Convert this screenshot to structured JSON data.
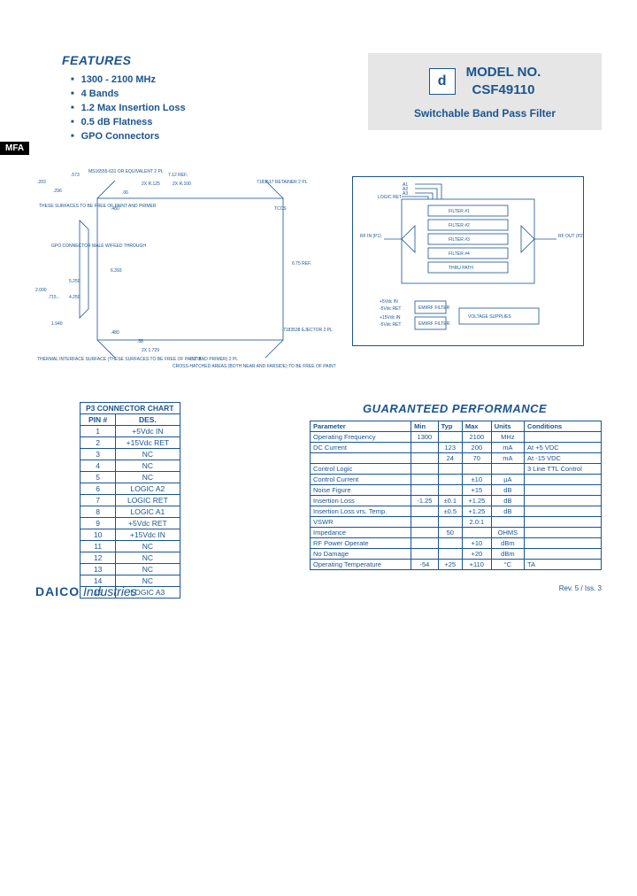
{
  "tag": "MFA",
  "features": {
    "heading": "FEATURES",
    "items": [
      "1300 - 2100 MHz",
      "4 Bands",
      "1.2 Max Insertion Loss",
      "0.5 dB Flatness",
      "GPO Connectors"
    ]
  },
  "model_box": {
    "logo_glyph": "d",
    "label_line1": "MODEL NO.",
    "label_line2": "CSF49110",
    "subtitle": "Switchable Band Pass Filter"
  },
  "mech_drawing": {
    "dims": {
      "w_ref": "7.12 REF.",
      "h_ref": "6.75 REF.",
      "left_203": ".203",
      "left_296": ".296",
      "left_573": ".573",
      "left_note1": "MS16555-631 OR EQUIVALENT 2 PL",
      "r125": "2X R.125",
      "r100": "2X R.100",
      "right_retainer": "7183517 RETAINER 2 PL",
      "tccs": "TCCS",
      "top_480": ".480",
      "top_06": ".06",
      "surfaces_note": "THESE SURFACES TO BE FREE OF PAINT AND PRIMER",
      "gpo_note": "GPO CONNECTOR MALE W/FEED THROUGH",
      "gpo_6393": "6.393",
      "left_2000": "2.000",
      "left_715": ".715",
      "left_arrow": "←",
      "left_5250": "5.250",
      "left_4250": "4.250",
      "left_1940": "1.940",
      "bot_480": ".480",
      "bot_58": ".58",
      "bot_2x1729": "2X 1.729",
      "bot_6778": "6.778",
      "ejector": "7183538 EJECTOR 2 PL",
      "thermal_note": "THERMAL INTERFACE SURFACE (THESE SURFACES TO BE FREE OF PAINT AND PRIMER) 2 PL",
      "hatch_note": "CROSS-HATCHED AREAS (BOTH NEAR AND FARSIDE) TO BE FREE OF PAINT AND PRIMER."
    }
  },
  "block_diagram": {
    "inputs": [
      "A1",
      "A2",
      "A3",
      "LOGIC RET"
    ],
    "rf_in": "RF IN (P1)",
    "rf_out": "RF OUT (P2)",
    "filters": [
      "FILTER #1",
      "FILTER #2",
      "FILTER #3",
      "FILTER #4",
      "THRU PATH"
    ],
    "power_pins": [
      "+5Vdc IN",
      "-5Vdc RET",
      "+15Vdc IN",
      "-5Vdc RET"
    ],
    "emi1": "EMI/RF FILTER",
    "emi2": "EMI/RF FILTER",
    "vs": "VOLTAGE SUPPLIES"
  },
  "pin_table": {
    "title": "P3 CONNECTOR CHART",
    "headers": [
      "PIN #",
      "DES."
    ],
    "rows": [
      [
        "1",
        "+5Vdc IN"
      ],
      [
        "2",
        "+15Vdc RET"
      ],
      [
        "3",
        "NC"
      ],
      [
        "4",
        "NC"
      ],
      [
        "5",
        "NC"
      ],
      [
        "6",
        "LOGIC A2"
      ],
      [
        "7",
        "LOGIC RET"
      ],
      [
        "8",
        "LOGIC A1"
      ],
      [
        "9",
        "+5Vdc RET"
      ],
      [
        "10",
        "+15Vdc IN"
      ],
      [
        "11",
        "NC"
      ],
      [
        "12",
        "NC"
      ],
      [
        "13",
        "NC"
      ],
      [
        "14",
        "NC"
      ],
      [
        "15",
        "LOGIC A3"
      ]
    ]
  },
  "perf_table": {
    "heading": "GUARANTEED PERFORMANCE",
    "headers": [
      "Parameter",
      "Min",
      "Typ",
      "Max",
      "Units",
      "Conditions"
    ],
    "rows": [
      [
        "Operating Frequency",
        "1300",
        "",
        "2100",
        "MHz",
        ""
      ],
      [
        "DC Current",
        "",
        "123",
        "200",
        "mA",
        "At +5 VDC"
      ],
      [
        "",
        "",
        "24",
        "70",
        "mA",
        "At -15 VDC"
      ],
      [
        "Control Logic",
        "",
        "",
        "",
        "",
        "3 Line TTL Control"
      ],
      [
        "Control Current",
        "",
        "",
        "±10",
        "µA",
        ""
      ],
      [
        "Noise Figure",
        "",
        "",
        "+15",
        "dB",
        ""
      ],
      [
        "Insertion Loss",
        "-1.25",
        "±0.1",
        "+1.25",
        "dB",
        ""
      ],
      [
        "Insertion Loss vrs. Temp.",
        "",
        "±0.5",
        "+1.25",
        "dB",
        ""
      ],
      [
        "VSWR",
        "",
        "",
        "2.0:1",
        "",
        ""
      ],
      [
        "Impedance",
        "",
        "50",
        "",
        "OHMS",
        ""
      ],
      [
        "RF Power       Operate",
        "",
        "",
        "+10",
        "dBm",
        ""
      ],
      [
        "             No Damage",
        "",
        "",
        "+20",
        "dBm",
        ""
      ],
      [
        "Operating Temperature",
        "-54",
        "+25",
        "+110",
        "°C",
        "TA"
      ]
    ]
  },
  "footer": {
    "company_bold": "DAICO",
    "company_italic": " Industries",
    "rev": "Rev. 5 / Iss. 3"
  }
}
